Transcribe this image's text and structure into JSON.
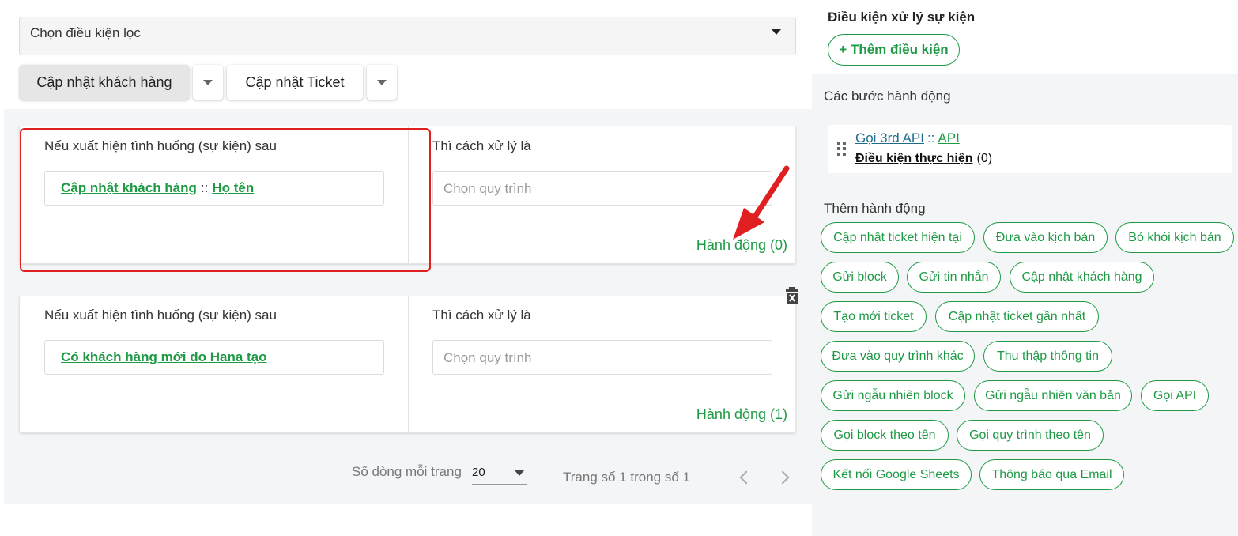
{
  "filter": {
    "placeholder": "Chọn điều kiện lọc"
  },
  "tabs": [
    {
      "label": "Cập nhật khách hàng",
      "active": true
    },
    {
      "label": "Cập nhật Ticket",
      "active": false
    }
  ],
  "rules": [
    {
      "event_label": "Nếu xuất hiện tình huống (sự kiện) sau",
      "event_primary": "Cập nhật khách hàng",
      "event_separator": "::",
      "event_secondary": "Họ tên",
      "process_label": "Thì cách xử lý là",
      "process_placeholder": "Chọn quy trình",
      "action_link": "Hành động (0)"
    },
    {
      "event_label": "Nếu xuất hiện tình huống (sự kiện) sau",
      "event_primary": "Có khách hàng mới do Hana tạo",
      "process_label": "Thì cách xử lý là",
      "process_placeholder": "Chọn quy trình",
      "action_link": "Hành động (1)"
    }
  ],
  "pagination": {
    "rows_label": "Số dòng mỗi trang",
    "rows_value": "20",
    "page_info": "Trang số 1 trong số 1"
  },
  "sidebar": {
    "conditions_title": "Điều kiện xử lý sự kiện",
    "add_condition_button": "+ Thêm điều kiện",
    "steps_title": "Các bước hành động",
    "step": {
      "name": "Gọi 3rd API",
      "separator": "::",
      "type": "API",
      "condition_label": "Điều kiện thực hiện",
      "condition_count": "(0)"
    },
    "add_action_title": "Thêm hành động",
    "actions": [
      "Cập nhật ticket hiện tại",
      "Đưa vào kịch bản",
      "Bỏ khỏi kịch bản",
      "Gửi block",
      "Gửi tin nhắn",
      "Cập nhật khách hàng",
      "Tạo mới ticket",
      "Cập nhật ticket gần nhất",
      "Đưa vào quy trình khác",
      "Thu thập thông tin",
      "Gửi ngẫu nhiên block",
      "Gửi ngẫu nhiên văn bản",
      "Gọi API",
      "Gọi block theo tên",
      "Gọi quy trình theo tên",
      "Kết nối Google Sheets",
      "Thông báo qua Email"
    ]
  },
  "colors": {
    "accent_green": "#1e9a45",
    "link_blue": "#1f6b8e",
    "highlight_red": "#e02020"
  }
}
